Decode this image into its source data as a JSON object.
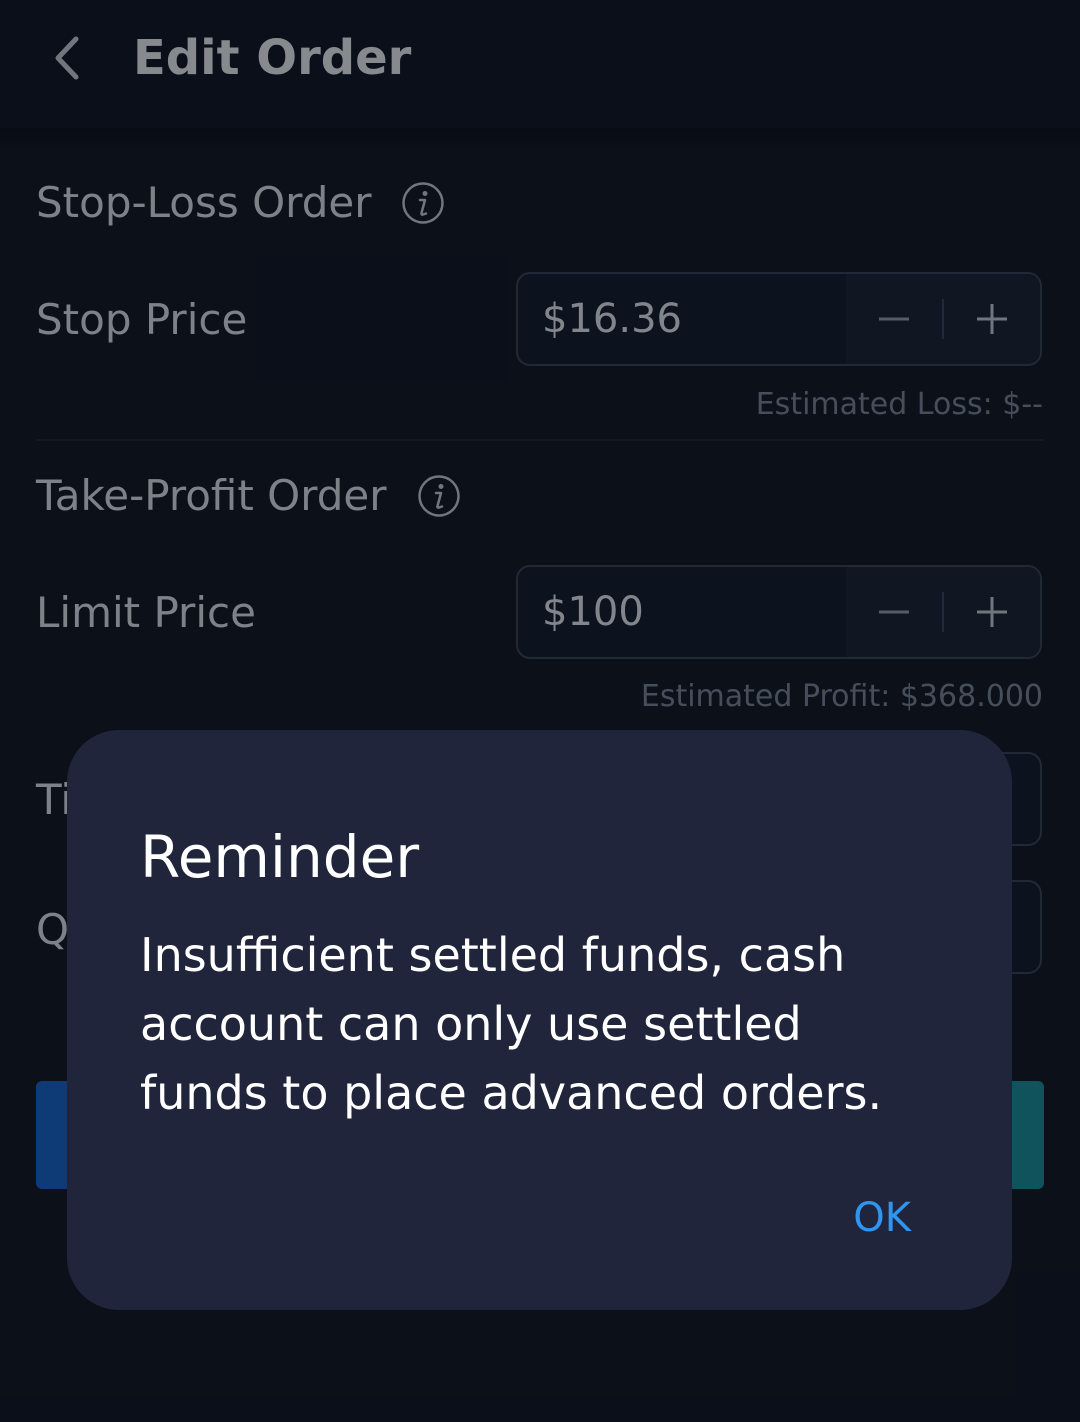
{
  "header": {
    "title": "Edit Order"
  },
  "stop_loss": {
    "section_title": "Stop-Loss Order",
    "field_label": "Stop Price",
    "value": "$16.36",
    "estimate": "Estimated Loss: $--"
  },
  "take_profit": {
    "section_title": "Take-Profit Order",
    "field_label": "Limit Price",
    "value": "$100",
    "estimate": "Estimated Profit: $368.000"
  },
  "obscured_rows": {
    "row1_label_partial": "Ti",
    "row2_label_partial": "Q"
  },
  "dialog": {
    "title": "Reminder",
    "message": "Insufficient settled funds, cash account can only use settled funds to place advanced orders.",
    "ok_label": "OK"
  },
  "colors": {
    "background": "#0f1420",
    "dialog_background": "#20253c",
    "link_blue": "#2f95ef",
    "primary_button": "#1562c8",
    "secondary_button": "#1a8f9c"
  }
}
